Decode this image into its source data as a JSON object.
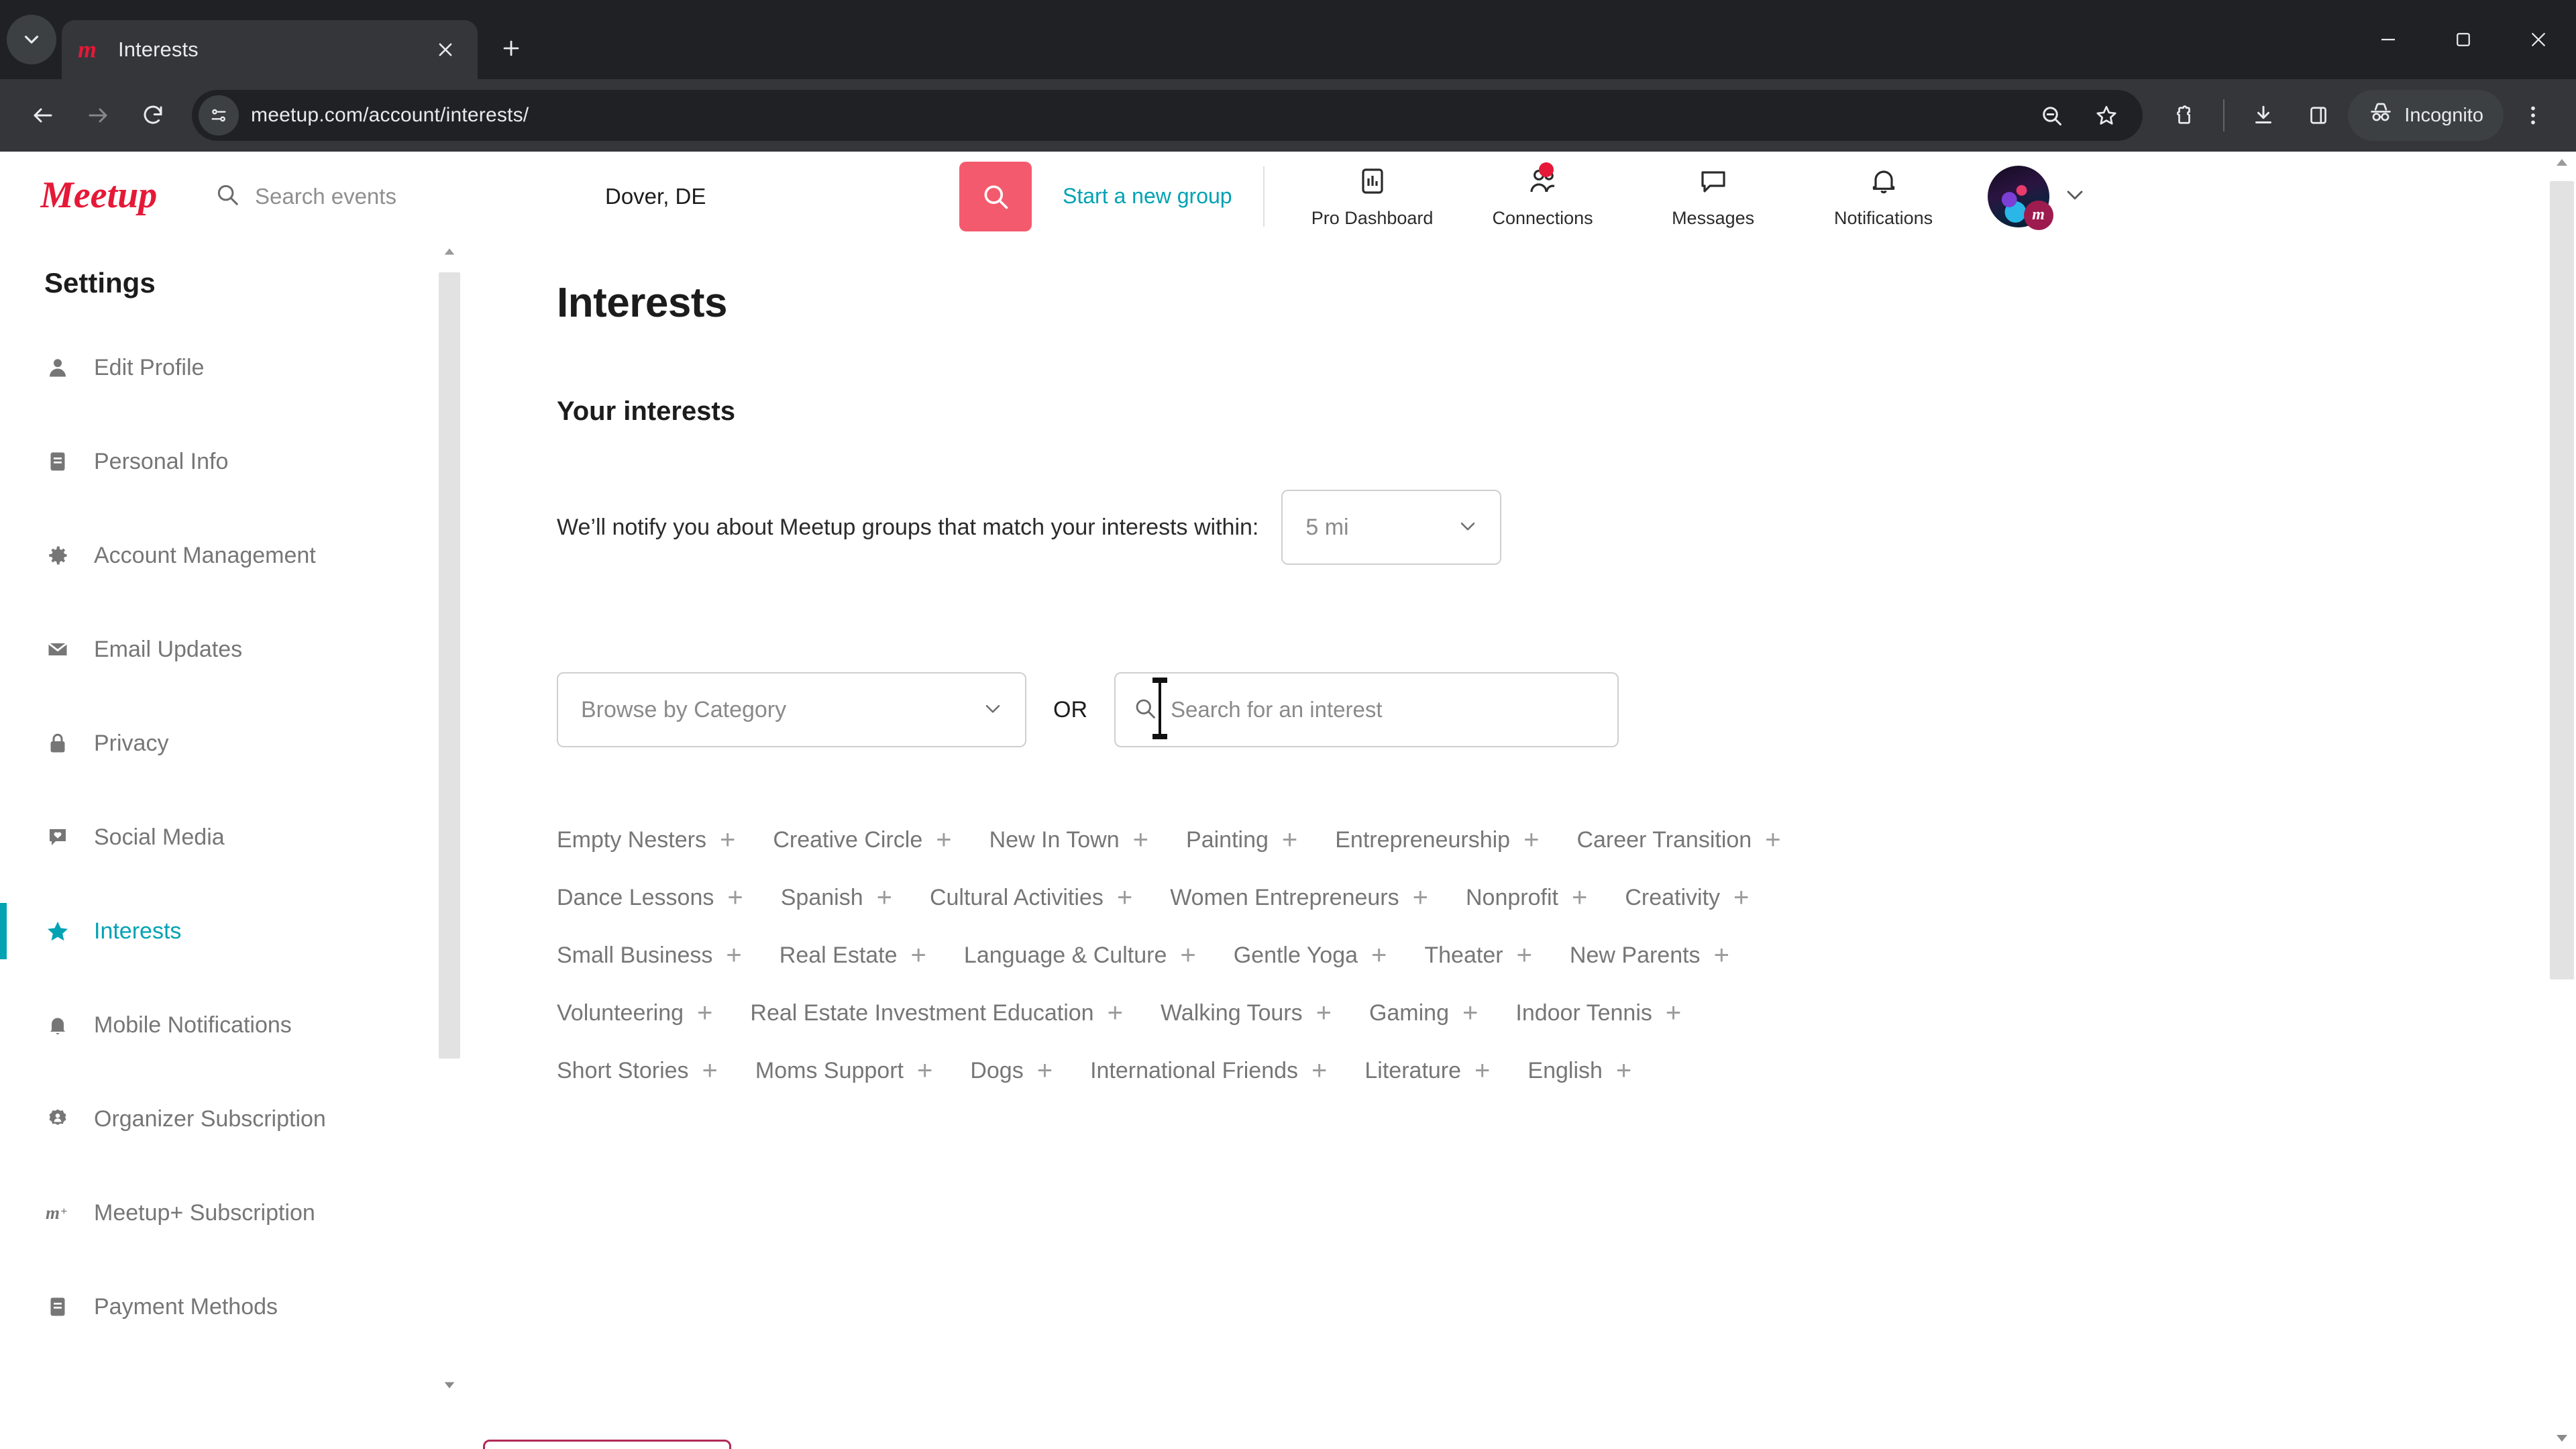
{
  "browser": {
    "tab": {
      "title": "Interests",
      "favicon": "meetup-m-icon"
    },
    "new_tab_label": "+",
    "url": "meetup.com/account/interests/",
    "incognito_label": "Incognito",
    "toolbar_icons": [
      "back-icon",
      "forward-icon",
      "reload-icon",
      "site-info-icon",
      "zoom-out-icon",
      "bookmark-star-icon",
      "extensions-icon",
      "downloads-icon",
      "side-panel-icon",
      "incognito-icon",
      "chrome-menu-icon"
    ],
    "window_controls": [
      "minimize",
      "maximize",
      "close"
    ]
  },
  "header": {
    "logo_text": "Meetup",
    "search_placeholder": "Search events",
    "search_value": "",
    "location_value": "Dover, DE",
    "search_button": "search-icon",
    "start_group_label": "Start a new group",
    "nav": [
      {
        "label": "Pro Dashboard",
        "icon": "pro-dashboard-icon",
        "badge": false
      },
      {
        "label": "Connections",
        "icon": "connections-icon",
        "badge": true
      },
      {
        "label": "Messages",
        "icon": "messages-icon",
        "badge": false
      },
      {
        "label": "Notifications",
        "icon": "notifications-bell-icon",
        "badge": false
      }
    ],
    "avatar_badge": "m"
  },
  "sidebar": {
    "title": "Settings",
    "items": [
      {
        "label": "Edit Profile",
        "icon": "person-icon",
        "active": false
      },
      {
        "label": "Personal Info",
        "icon": "id-card-icon",
        "active": false
      },
      {
        "label": "Account Management",
        "icon": "gear-icon",
        "active": false
      },
      {
        "label": "Email Updates",
        "icon": "envelope-icon",
        "active": false
      },
      {
        "label": "Privacy",
        "icon": "lock-icon",
        "active": false
      },
      {
        "label": "Social Media",
        "icon": "social-media-icon",
        "active": false
      },
      {
        "label": "Interests",
        "icon": "star-icon",
        "active": true
      },
      {
        "label": "Mobile Notifications",
        "icon": "bell-icon",
        "active": false
      },
      {
        "label": "Organizer Subscription",
        "icon": "badge-person-icon",
        "active": false
      },
      {
        "label": "Meetup+ Subscription",
        "icon": "meetup-plus-icon",
        "active": false
      },
      {
        "label": "Payment Methods",
        "icon": "card-icon",
        "active": false
      }
    ]
  },
  "main": {
    "page_title": "Interests",
    "section_title": "Your interests",
    "notify_text": "We’ll notify you about Meetup groups that match your interests within:",
    "radius_value": "5 mi",
    "browse_placeholder": "Browse by Category",
    "or_label": "OR",
    "interest_search_placeholder": "Search for an interest",
    "interest_search_value": "",
    "add_glyph": "+",
    "tag_rows": [
      [
        "Empty Nesters",
        "Creative Circle",
        "New In Town",
        "Painting",
        "Entrepreneurship",
        "Career Transition"
      ],
      [
        "Dance Lessons",
        "Spanish",
        "Cultural Activities",
        "Women Entrepreneurs",
        "Nonprofit",
        "Creativity"
      ],
      [
        "Small Business",
        "Real Estate",
        "Language & Culture",
        "Gentle Yoga",
        "Theater",
        "New Parents"
      ],
      [
        "Volunteering",
        "Real Estate Investment Education",
        "Walking Tours",
        "Gaming",
        "Indoor Tennis"
      ],
      [
        "Short Stories",
        "Moms Support",
        "Dogs",
        "International Friends",
        "Literature",
        "English"
      ]
    ]
  },
  "colors": {
    "meetup_red": "#e51937",
    "accent_teal": "#00a2b3",
    "search_button": "#f45a6d",
    "muted_text": "#767676",
    "chrome_dark": "#35363a",
    "chrome_darker": "#202124"
  }
}
